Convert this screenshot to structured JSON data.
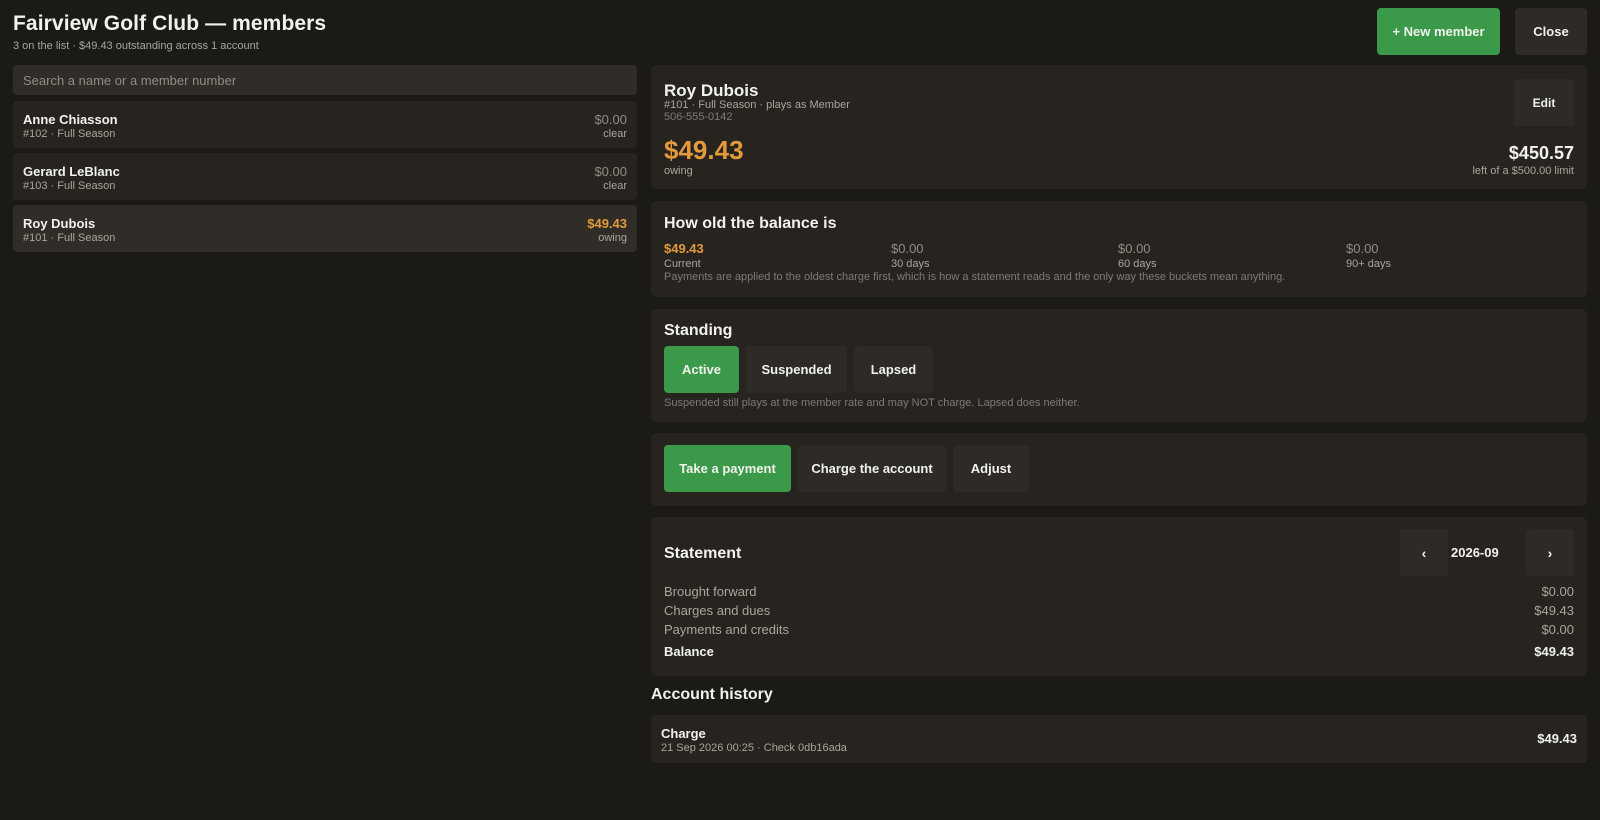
{
  "header": {
    "title": "Fairview Golf Club — members",
    "subtitle": "3 on the list · $49.43 outstanding across 1 account",
    "new_member_label": "+ New member",
    "close_label": "Close"
  },
  "search": {
    "placeholder": "Search a name or a member number",
    "value": ""
  },
  "members": [
    {
      "name": "Anne Chiasson",
      "meta": "#102 · Full Season",
      "amount": "$0.00",
      "status": "clear"
    },
    {
      "name": "Gerard LeBlanc",
      "meta": "#103 · Full Season",
      "amount": "$0.00",
      "status": "clear"
    },
    {
      "name": "Roy Dubois",
      "meta": "#101 · Full Season",
      "amount": "$49.43",
      "status": "owing",
      "selected": true
    }
  ],
  "profile": {
    "name": "Roy Dubois",
    "meta": "#101 · Full Season · plays as Member",
    "phone": "506-555-0142",
    "owing_amount": "$49.43",
    "owing_label": "owing",
    "edit_label": "Edit",
    "left_amount": "$450.57",
    "left_label": "left of a $500.00 limit"
  },
  "aging": {
    "title": "How old the balance is",
    "buckets": [
      {
        "amount": "$49.43",
        "label": "Current"
      },
      {
        "amount": "$0.00",
        "label": "30 days"
      },
      {
        "amount": "$0.00",
        "label": "60 days"
      },
      {
        "amount": "$0.00",
        "label": "90+ days"
      }
    ],
    "note": "Payments are applied to the oldest charge first, which is how a statement reads and the only way these buckets mean anything."
  },
  "standing": {
    "title": "Standing",
    "options": [
      "Active",
      "Suspended",
      "Lapsed"
    ],
    "selected": "Active",
    "note": "Suspended still plays at the member rate and may NOT charge. Lapsed does neither."
  },
  "actions": {
    "take_payment": "Take a payment",
    "charge_account": "Charge the account",
    "adjust": "Adjust"
  },
  "statement": {
    "title": "Statement",
    "month": "2026-09",
    "prev_label": "‹",
    "next_label": "›",
    "rows": [
      {
        "label": "Brought forward",
        "value": "$0.00"
      },
      {
        "label": "Charges and dues",
        "value": "$49.43"
      },
      {
        "label": "Payments and credits",
        "value": "$0.00"
      },
      {
        "label": "Balance",
        "value": "$49.43"
      }
    ]
  },
  "history": {
    "title": "Account history",
    "items": [
      {
        "type": "Charge",
        "meta": "21 Sep 2026 00:25 · Check 0db16ada",
        "amount": "$49.43"
      }
    ]
  },
  "colors": {
    "background": "#1c1a16",
    "panel": "#272420",
    "accent_green": "#3a9a4a",
    "owing_orange": "#e29a3a"
  }
}
